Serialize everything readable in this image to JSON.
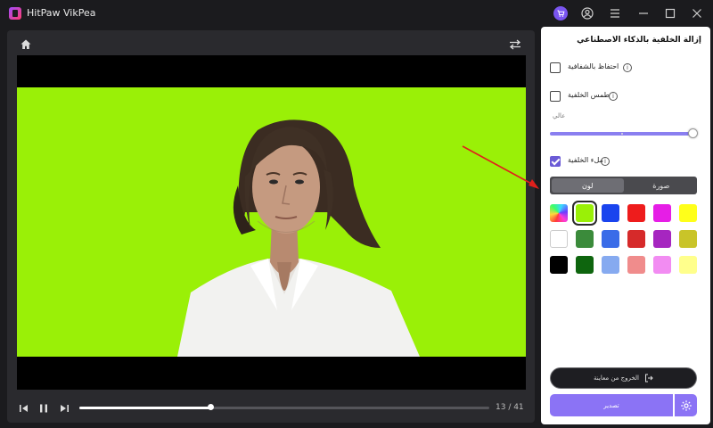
{
  "app": {
    "title": "HitPaw VikPea"
  },
  "titlebar": {
    "icons": [
      "cart-icon",
      "account-icon",
      "menu-icon",
      "minimize-icon",
      "maximize-icon",
      "close-icon"
    ]
  },
  "preview": {
    "background_color": "#9af007",
    "timeline": {
      "current_frame": "13",
      "total_frames": "41",
      "progress": 0.32,
      "time_text": "13 / 41"
    }
  },
  "panel": {
    "title": "إزالة الخلفية بالذكاء الاصطناعي",
    "keep_transparency": {
      "label": "احتفاظ بالشفافية",
      "checked": false
    },
    "blur_background": {
      "label": "طمس الخلفية",
      "checked": false
    },
    "blur_level": {
      "label": "عالي",
      "value": 1.0
    },
    "fill_background": {
      "label": "ملء الخلفية",
      "checked": true
    },
    "tabs": [
      {
        "label": "صورة",
        "active": false
      },
      {
        "label": "لون",
        "active": true
      }
    ],
    "colors": [
      [
        "gradient",
        "#9af007",
        "#1a44ee",
        "#ee1c1c",
        "#e61ee6",
        "#ffff1a"
      ],
      [
        "#ffffff",
        "#3b8b3b",
        "#3a6ce8",
        "#d62a2a",
        "#a626c0",
        "#c9c429"
      ],
      [
        "#000000",
        "#0e650e",
        "#86aaf0",
        "#f08c8c",
        "#f28cf2",
        "#ffff8c"
      ]
    ],
    "selected_color": "#9af007",
    "exit_preview_label": "الخروج من معاينة",
    "export_label": "تصدير"
  }
}
